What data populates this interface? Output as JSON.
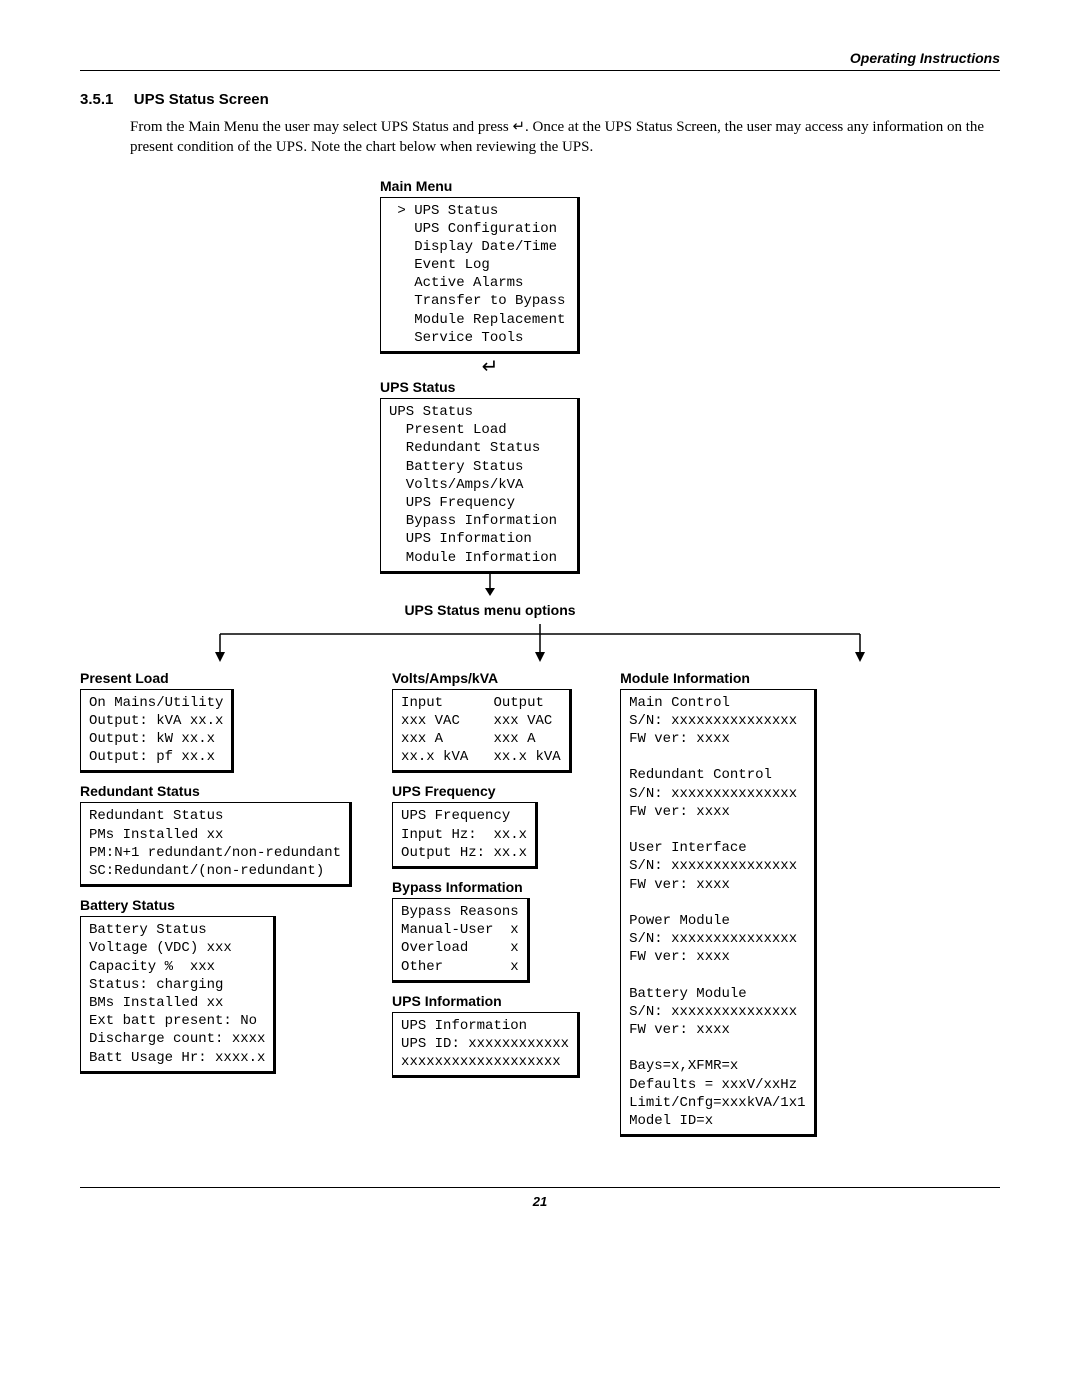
{
  "header": {
    "right": "Operating Instructions"
  },
  "section": {
    "num": "3.5.1",
    "title": "UPS Status Screen"
  },
  "paragraph": "From the Main Menu the user may select UPS Status and press ↵. Once at the UPS Status Screen, the user may access any information on the present condition of the UPS. Note the chart below when reviewing the UPS.",
  "main_menu": {
    "title": "Main Menu",
    "lines": " > UPS Status\n   UPS Configuration\n   Display Date/Time\n   Event Log\n   Active Alarms\n   Transfer to Bypass\n   Module Replacement\n   Service Tools"
  },
  "enter_glyph": "↵",
  "ups_status": {
    "title": "UPS Status",
    "lines": "UPS Status\n  Present Load\n  Redundant Status\n  Battery Status\n  Volts/Amps/kVA\n  UPS Frequency\n  Bypass Information\n  UPS Information\n  Module Information"
  },
  "options_label": "UPS Status menu options",
  "present_load": {
    "title": "Present Load",
    "lines": "On Mains/Utility\nOutput: kVA xx.x\nOutput: kW xx.x\nOutput: pf xx.x"
  },
  "redundant_status": {
    "title": "Redundant Status",
    "lines": "Redundant Status\nPMs Installed xx\nPM:N+1 redundant/non-redundant\nSC:Redundant/(non-redundant)"
  },
  "battery_status": {
    "title": "Battery Status",
    "lines": "Battery Status\nVoltage (VDC) xxx\nCapacity %  xxx\nStatus: charging\nBMs Installed xx\nExt batt present: No\nDischarge count: xxxx\nBatt Usage Hr: xxxx.x"
  },
  "vak": {
    "title": "Volts/Amps/kVA",
    "lines": "Input      Output\nxxx VAC    xxx VAC\nxxx A      xxx A\nxx.x kVA   xx.x kVA"
  },
  "ups_freq": {
    "title": "UPS Frequency",
    "lines": "UPS Frequency\nInput Hz:  xx.x\nOutput Hz: xx.x"
  },
  "bypass": {
    "title": "Bypass Information",
    "lines": "Bypass Reasons\nManual-User  x\nOverload     x\nOther        x"
  },
  "ups_info": {
    "title": "UPS Information",
    "lines": "UPS Information\nUPS ID: xxxxxxxxxxxx\nxxxxxxxxxxxxxxxxxxx"
  },
  "module_info": {
    "title": "Module Information",
    "lines": "Main Control\nS/N: xxxxxxxxxxxxxxx\nFW ver: xxxx\n\nRedundant Control\nS/N: xxxxxxxxxxxxxxx\nFW ver: xxxx\n\nUser Interface\nS/N: xxxxxxxxxxxxxxx\nFW ver: xxxx\n\nPower Module\nS/N: xxxxxxxxxxxxxxx\nFW ver: xxxx\n\nBattery Module\nS/N: xxxxxxxxxxxxxxx\nFW ver: xxxx\n\nBays=x,XFMR=x\nDefaults = xxxV/xxHz\nLimit/Cnfg=xxxkVA/1x1\nModel ID=x"
  },
  "page_number": "21"
}
